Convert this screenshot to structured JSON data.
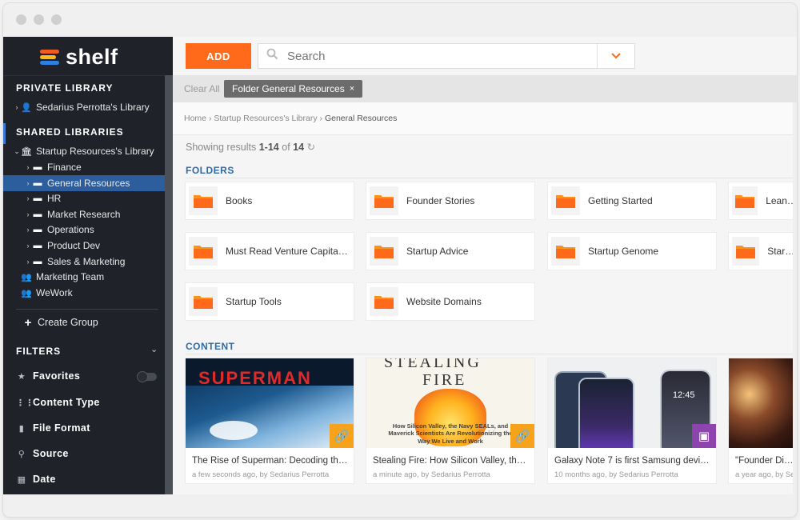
{
  "app": {
    "logo_text": "shelf",
    "brand_colors": [
      "#f15a24",
      "#ffb71b",
      "#2f7fe0"
    ]
  },
  "sidebar": {
    "private_title": "PRIVATE LIBRARY",
    "private_items": [
      {
        "label": "Sedarius Perrotta's Library",
        "icon": "user-icon"
      }
    ],
    "shared_title": "SHARED LIBRARIES",
    "shared_root": {
      "label": "Startup Resources's Library",
      "icon": "bank-icon"
    },
    "shared_children": [
      {
        "label": "Finance"
      },
      {
        "label": "General Resources",
        "active": true
      },
      {
        "label": "HR"
      },
      {
        "label": "Market Research"
      },
      {
        "label": "Operations"
      },
      {
        "label": "Product Dev"
      },
      {
        "label": "Sales & Marketing"
      }
    ],
    "groups": [
      {
        "label": "Marketing Team"
      },
      {
        "label": "WeWork"
      }
    ],
    "create_group": "Create Group",
    "filters_title": "FILTERS",
    "filters": [
      {
        "label": "Favorites",
        "icon": "star-icon"
      },
      {
        "label": "Content Type",
        "icon": "grid-icon"
      },
      {
        "label": "File Format",
        "icon": "file-icon"
      },
      {
        "label": "Source",
        "icon": "search-icon"
      },
      {
        "label": "Date",
        "icon": "calendar-icon"
      }
    ]
  },
  "toolbar": {
    "add_label": "ADD",
    "search_placeholder": "Search"
  },
  "filterbar": {
    "clear_all": "Clear All",
    "chip_label": "Folder General Resources",
    "chip_close": "×"
  },
  "breadcrumb": {
    "home": "Home",
    "library": "Startup Resources's Library",
    "current": "General Resources",
    "sep": "›"
  },
  "results": {
    "prefix": "Showing results",
    "range": "1-14",
    "of": "of",
    "total": "14"
  },
  "folders": {
    "title": "FOLDERS",
    "items": [
      {
        "name": "Books"
      },
      {
        "name": "Founder Stories"
      },
      {
        "name": "Getting Started"
      },
      {
        "name": "Lean La"
      },
      {
        "name": "Must Read Venture Capital ..."
      },
      {
        "name": "Startup Advice"
      },
      {
        "name": "Startup Genome"
      },
      {
        "name": "Startup"
      },
      {
        "name": "Startup Tools"
      },
      {
        "name": "Website Domains"
      }
    ]
  },
  "content": {
    "title": "CONTENT",
    "items": [
      {
        "title": "The Rise of Superman: Decoding the S...",
        "meta": "a few seconds ago, by Sedarius Perrotta",
        "thumb_text": "SUPERMAN",
        "badge": "link-icon",
        "badge_color": "#f7a21b"
      },
      {
        "title": "Stealing Fire: How Silicon Valley, the N...",
        "meta": "a minute ago, by Sedarius Perrotta",
        "thumb_title_1": "STEALING",
        "thumb_title_2": "FIRE",
        "thumb_sub": "How Silicon Valley, the Navy SEALs, and Maverick Scientists Are Revolutionizing the Way We Live and Work",
        "badge": "link-icon",
        "badge_color": "#f7a21b"
      },
      {
        "title": "Galaxy Note 7 is first Samsung device ...",
        "meta": "10 months ago, by Sedarius Perrotta",
        "thumb_text": "12:45",
        "badge": "image-icon",
        "badge_color": "#8e44ad"
      },
      {
        "title": "\"Founder Dinne",
        "meta": "a year ago, by Sec",
        "badge": "",
        "badge_color": ""
      }
    ]
  }
}
